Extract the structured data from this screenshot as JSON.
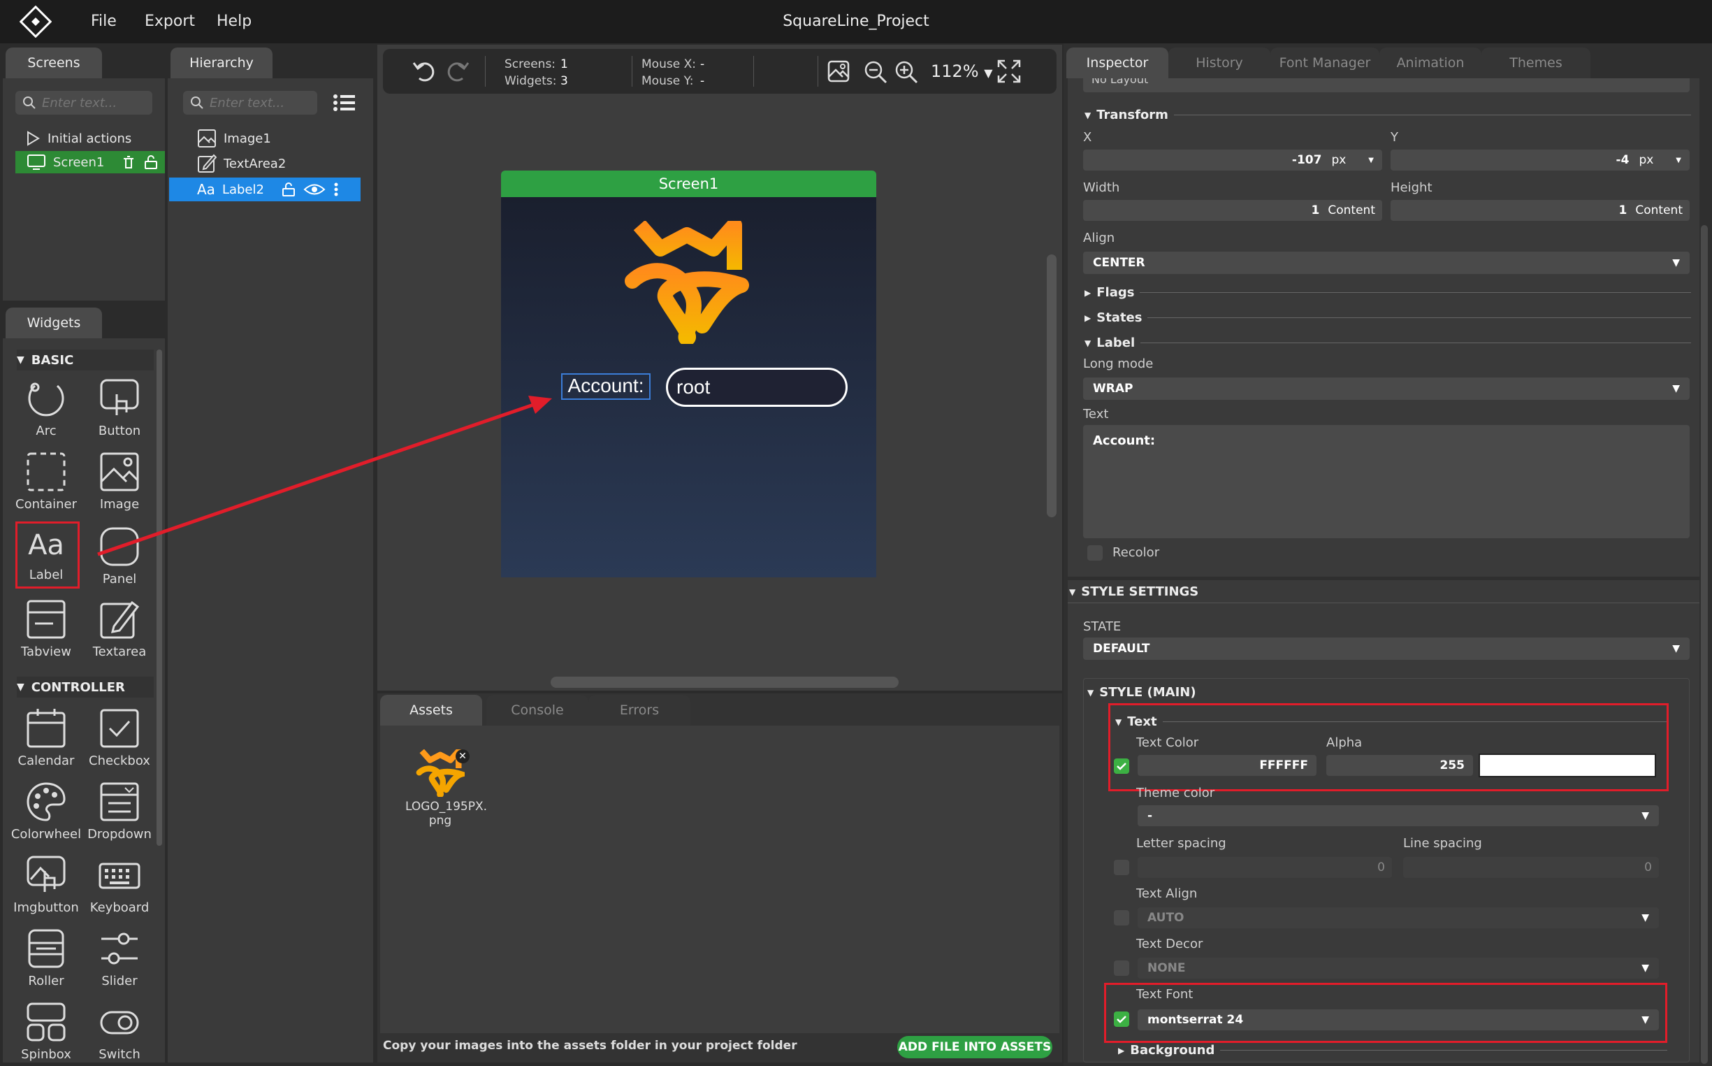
{
  "app": {
    "title": "SquareLine_Project",
    "menu": [
      "File",
      "Export",
      "Help"
    ]
  },
  "screens_panel": {
    "tab": "Screens",
    "search_placeholder": "Enter text...",
    "items": [
      {
        "label": "Initial actions"
      },
      {
        "label": "Screen1"
      }
    ]
  },
  "hierarchy": {
    "tab": "Hierarchy",
    "search_placeholder": "Enter text...",
    "items": [
      {
        "label": "Image1"
      },
      {
        "label": "TextArea2"
      },
      {
        "label": "Label2"
      }
    ]
  },
  "widgets": {
    "tab": "Widgets",
    "basic_title": "BASIC",
    "controller_title": "CONTROLLER",
    "basic": [
      "Arc",
      "Button",
      "Container",
      "Image",
      "Label",
      "Panel",
      "Tabview",
      "Textarea"
    ],
    "controller": [
      "Calendar",
      "Checkbox",
      "Colorwheel",
      "Dropdown",
      "Imgbutton",
      "Keyboard",
      "Roller",
      "Slider",
      "Spinbox",
      "Switch"
    ]
  },
  "toolbar": {
    "screens_label": "Screens:",
    "screens_value": "1",
    "widgets_label": "Widgets:",
    "widgets_value": "3",
    "mouse_x_label": "Mouse X:",
    "mouse_x_value": "-",
    "mouse_y_label": "Mouse Y:",
    "mouse_y_value": "-",
    "zoom": "112%"
  },
  "canvas": {
    "screen_title": "Screen1",
    "label_text": "Account:",
    "textarea_text": "root",
    "screen_color": "#2ea043"
  },
  "bottom": {
    "tabs": [
      "Assets",
      "Console",
      "Errors"
    ],
    "asset_name": "LOGO_195PX.\npng",
    "footer_text": "Copy your images into the assets folder in your project folder",
    "add_button": "ADD FILE INTO ASSETS"
  },
  "inspector": {
    "tabs": [
      "Inspector",
      "History",
      "Font Manager",
      "Animation",
      "Themes"
    ],
    "top_cut": "No Layout",
    "transform": "Transform",
    "x_label": "X",
    "x_value": "-107",
    "x_unit": "px",
    "y_label": "Y",
    "y_value": "-4",
    "y_unit": "px",
    "width_label": "Width",
    "width_value": "1",
    "width_unit": "Content",
    "height_label": "Height",
    "height_value": "1",
    "height_unit": "Content",
    "align_label": "Align",
    "align_value": "CENTER",
    "flags": "Flags",
    "states": "States",
    "label_sec": "Label",
    "long_mode_label": "Long mode",
    "long_mode_value": "WRAP",
    "text_label": "Text",
    "text_value": "Account:",
    "recolor": "Recolor",
    "style_settings": "STYLE SETTINGS",
    "state_label": "STATE",
    "state_value": "DEFAULT",
    "style_main": "STYLE (MAIN)",
    "text_sec": "Text",
    "text_color_label": "Text Color",
    "text_color_value": "FFFFFF",
    "alpha_label": "Alpha",
    "alpha_value": "255",
    "theme_color_label": "Theme color",
    "theme_color_value": "-",
    "letter_spacing_label": "Letter spacing",
    "letter_spacing_value": "0",
    "line_spacing_label": "Line spacing",
    "line_spacing_value": "0",
    "text_align_label": "Text Align",
    "text_align_value": "AUTO",
    "text_decor_label": "Text Decor",
    "text_decor_value": "NONE",
    "text_font_label": "Text Font",
    "text_font_value": "montserrat 24",
    "background": "Background"
  },
  "colors": {
    "accent_blue": "#1e88e5",
    "green": "#3cb043",
    "annotation_red": "#e11d2a"
  }
}
